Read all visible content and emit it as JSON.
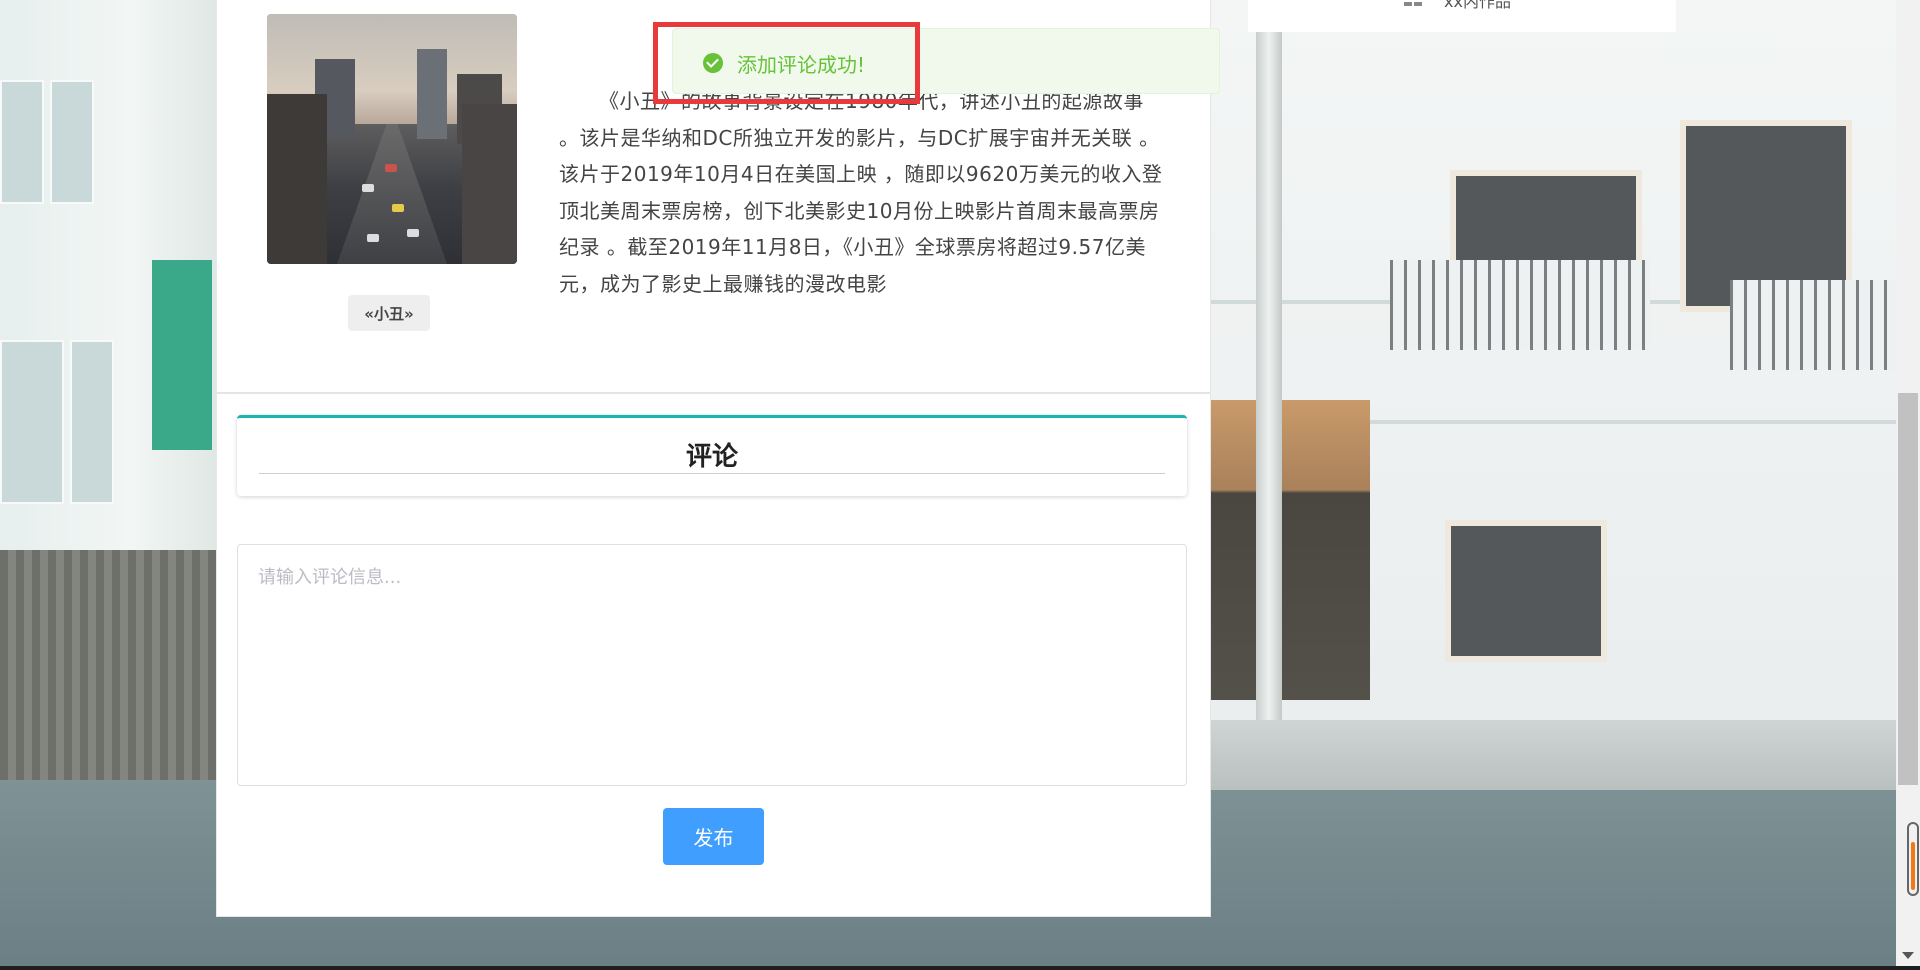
{
  "sidebar": {
    "partial_label": "xx内作品",
    "icon": "grid-icon"
  },
  "article": {
    "poster_caption": "«小丑»",
    "description": "《小丑》的故事背景设定在1980年代，讲述小丑的起源故事 。该片是华纳和DC所独立开发的影片，与DC扩展宇宙并无关联 。该片于2019年10月4日在美国上映 ，随即以9620万美元的收入登顶北美周末票房榜，创下北美影史10月份上映影片首周末最高票房纪录 。截至2019年11月8日，《小丑》全球票房将超过9.57亿美元，成为了影史上最赚钱的漫改电影"
  },
  "comments": {
    "title": "评论",
    "placeholder": "请输入评论信息...",
    "value": "",
    "publish_label": "发布"
  },
  "toast": {
    "message": "添加评论成功!",
    "type": "success",
    "icon": "check-circle-icon"
  },
  "colors": {
    "accent": "#1ab5b2",
    "primary_button": "#409eff",
    "success": "#67c23a",
    "highlight": "#e83a3a"
  }
}
